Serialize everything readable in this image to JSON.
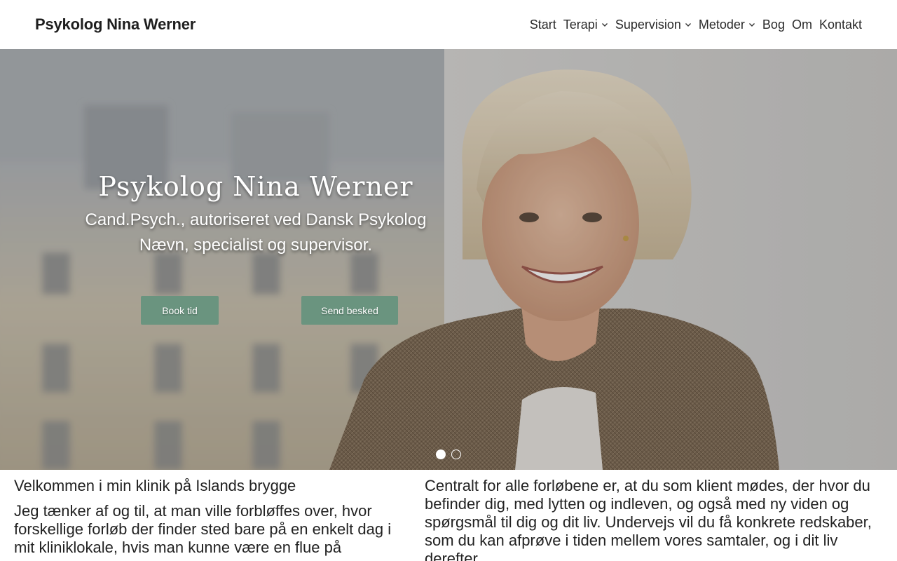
{
  "header": {
    "brand": "Psykolog Nina Werner",
    "nav": [
      {
        "label": "Start",
        "has_dropdown": false
      },
      {
        "label": "Terapi",
        "has_dropdown": true
      },
      {
        "label": "Supervision",
        "has_dropdown": true
      },
      {
        "label": "Metoder",
        "has_dropdown": true
      },
      {
        "label": "Bog",
        "has_dropdown": false
      },
      {
        "label": "Om",
        "has_dropdown": false
      },
      {
        "label": "Kontakt",
        "has_dropdown": false
      }
    ]
  },
  "hero": {
    "title": "Psykolog Nina Werner",
    "subtitle": "Cand.Psych., autoriseret ved Dansk Psykolog Nævn, specialist og supervisor.",
    "book_button": "Book tid",
    "message_button": "Send besked",
    "slides_total": 2,
    "active_slide": 1,
    "button_color": "#6a947f"
  },
  "content": {
    "left_heading": "Velkommen i min klinik på Islands brygge",
    "left_paragraph": "Jeg tænker af og til, at man ville forbløffes over, hvor forskellige forløb der finder sted bare på en enkelt dag i mit kliniklokale, hvis man kunne være en flue på væggen.",
    "right_paragraph": "Centralt for alle forløbene er, at du som klient mødes, der hvor du befinder dig, med lytten og indleven, og også med ny viden og spørgsmål til dig og dit liv. Undervejs vil du få konkrete redskaber, som du kan afprøve i tiden mellem vores samtaler, og i dit liv derefter."
  }
}
